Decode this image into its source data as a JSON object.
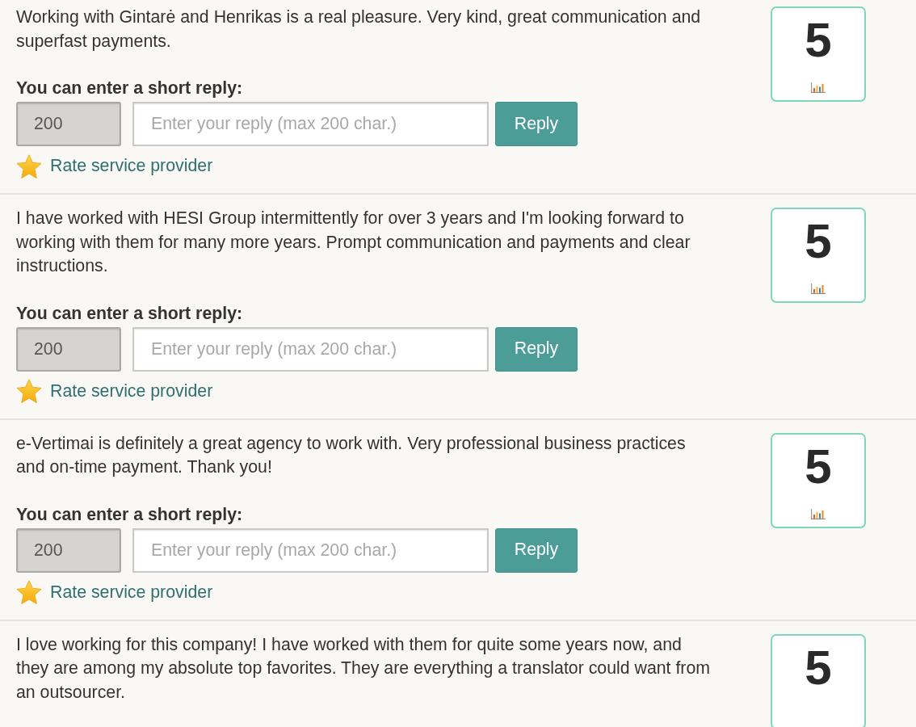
{
  "reviews": [
    {
      "text_lines": [
        "Working with Gintarė and Henrikas is a real pleasure. Very kind, great communication and",
        "superfast payments."
      ],
      "score": "5",
      "stats_icon": true,
      "reply_form": {
        "label": "You can enter a short reply:",
        "counter": "200",
        "placeholder": "Enter your reply (max 200 char.)",
        "button": "Reply",
        "rate_link": "Rate service provider"
      }
    },
    {
      "text_lines": [
        "I have worked with HESI Group intermittently for over 3 years and I'm looking forward to",
        "working with them for many more years. Prompt communication and payments and clear",
        "instructions."
      ],
      "score": "5",
      "stats_icon": true,
      "reply_form": {
        "label": "You can enter a short reply:",
        "counter": "200",
        "placeholder": "Enter your reply (max 200 char.)",
        "button": "Reply",
        "rate_link": "Rate service provider"
      }
    },
    {
      "text_lines": [
        "e-Vertimai is definitely a great agency to work with. Very professional business practices",
        "and on-time payment. Thank you!"
      ],
      "score": "5",
      "stats_icon": true,
      "reply_form": {
        "label": "You can enter a short reply:",
        "counter": "200",
        "placeholder": "Enter your reply (max 200 char.)",
        "button": "Reply",
        "rate_link": "Rate service provider"
      }
    },
    {
      "text_lines": [
        "I love working for this company! I have worked with them for quite some years now, and",
        "they are among my absolute top favorites. They are everything a translator could want from",
        "an outsourcer."
      ],
      "score": "5",
      "stats_icon": false
    }
  ]
}
